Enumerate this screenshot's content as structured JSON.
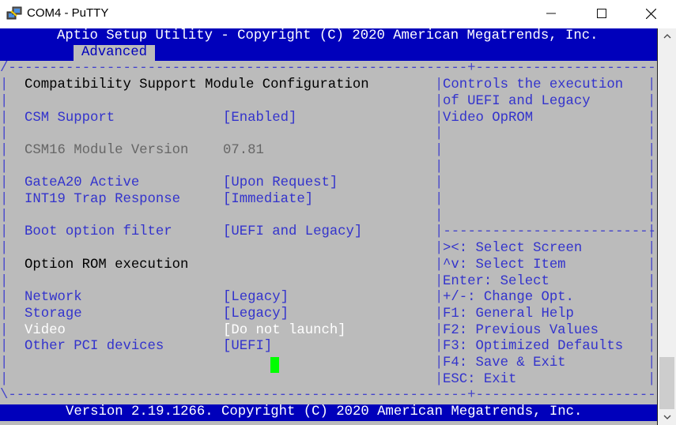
{
  "window": {
    "title": "COM4 - PuTTY",
    "icon": "putty-icon",
    "controls": {
      "minimize": "—",
      "maximize": "☐",
      "close": "✕"
    }
  },
  "bios": {
    "header": "Aptio Setup Utility - Copyright (C) 2020 American Megatrends, Inc.",
    "active_tab": "Advanced",
    "footer": "Version 2.19.1266. Copyright (C) 2020 American Megatrends, Inc.",
    "borders": {
      "top": "/--------------------------------------------------------+--------------------------\\",
      "bottom": "\\--------------------------------------------------------+--------------------------/",
      "help_divider": "|--------------------------|"
    },
    "section_title": "Compatibility Support Module Configuration",
    "settings": [
      {
        "label": "CSM Support",
        "value": "[Enabled]",
        "state": "selectable"
      },
      {
        "label": "CSM16 Module Version",
        "value": "07.81",
        "state": "readonly"
      },
      {
        "label": "GateA20 Active",
        "value": "[Upon Request]",
        "state": "selectable"
      },
      {
        "label": "INT19 Trap Response",
        "value": "[Immediate]",
        "state": "selectable"
      },
      {
        "label": "Boot option filter",
        "value": "[UEFI and Legacy]",
        "state": "selectable"
      },
      {
        "label": "Network",
        "value": "[Legacy]",
        "state": "selectable"
      },
      {
        "label": "Storage",
        "value": "[Legacy]",
        "state": "selectable"
      },
      {
        "label": "Video",
        "value": "[Do not launch]",
        "state": "highlighted"
      },
      {
        "label": "Other PCI devices",
        "value": "[UEFI]",
        "state": "selectable"
      }
    ],
    "subsection_title": "Option ROM execution",
    "help_text": [
      "Controls the execution",
      "of UEFI and Legacy",
      "Video OpROM"
    ],
    "key_help": [
      ">&lt;: Select Screen",
      "^v: Select Item",
      "Enter: Select",
      "+/-: Change Opt.",
      "F1: General Help",
      "F2: Previous Values",
      "F3: Optimized Defaults",
      "F4: Save & Exit",
      "ESC: Exit"
    ]
  },
  "colors": {
    "bar_blue": "#0000bb",
    "panel_gray": "#bbbbbb",
    "text_blue": "#3333cc",
    "cursor_green": "#00ff00"
  }
}
